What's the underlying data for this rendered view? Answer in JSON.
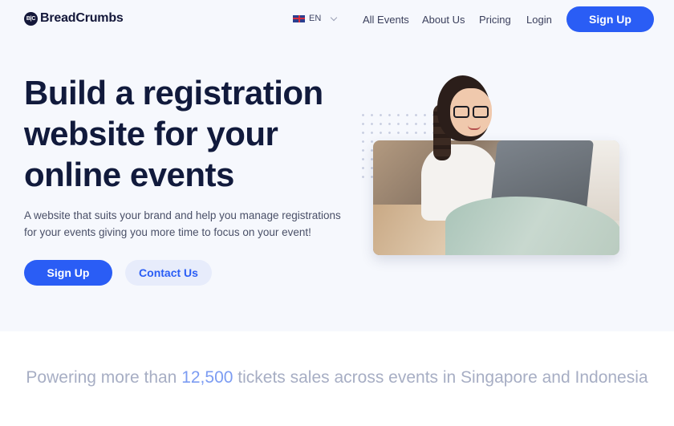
{
  "brand": {
    "logo_mark": "B|C",
    "name": "BreadCrumbs"
  },
  "nav": {
    "language": "EN",
    "links": [
      "All Events",
      "About Us",
      "Pricing",
      "Login"
    ],
    "signup_label": "Sign Up"
  },
  "hero": {
    "title": "Build a registration website for your online events",
    "subtitle": "A website that suits your brand and help you manage registrations for your events giving you more time to focus on your event!",
    "primary_cta": "Sign Up",
    "secondary_cta": "Contact Us"
  },
  "stats": {
    "prefix": "Powering more than ",
    "number": "12,500",
    "suffix": " tickets sales across events in Singapore and Indonesia"
  },
  "colors": {
    "accent": "#2a5df5",
    "heading": "#111a3c",
    "hero_bg": "#f6f8fd",
    "stats_number": "#7c9cf2"
  },
  "icons": [
    "uk-flag-icon",
    "chevron-down-icon"
  ]
}
